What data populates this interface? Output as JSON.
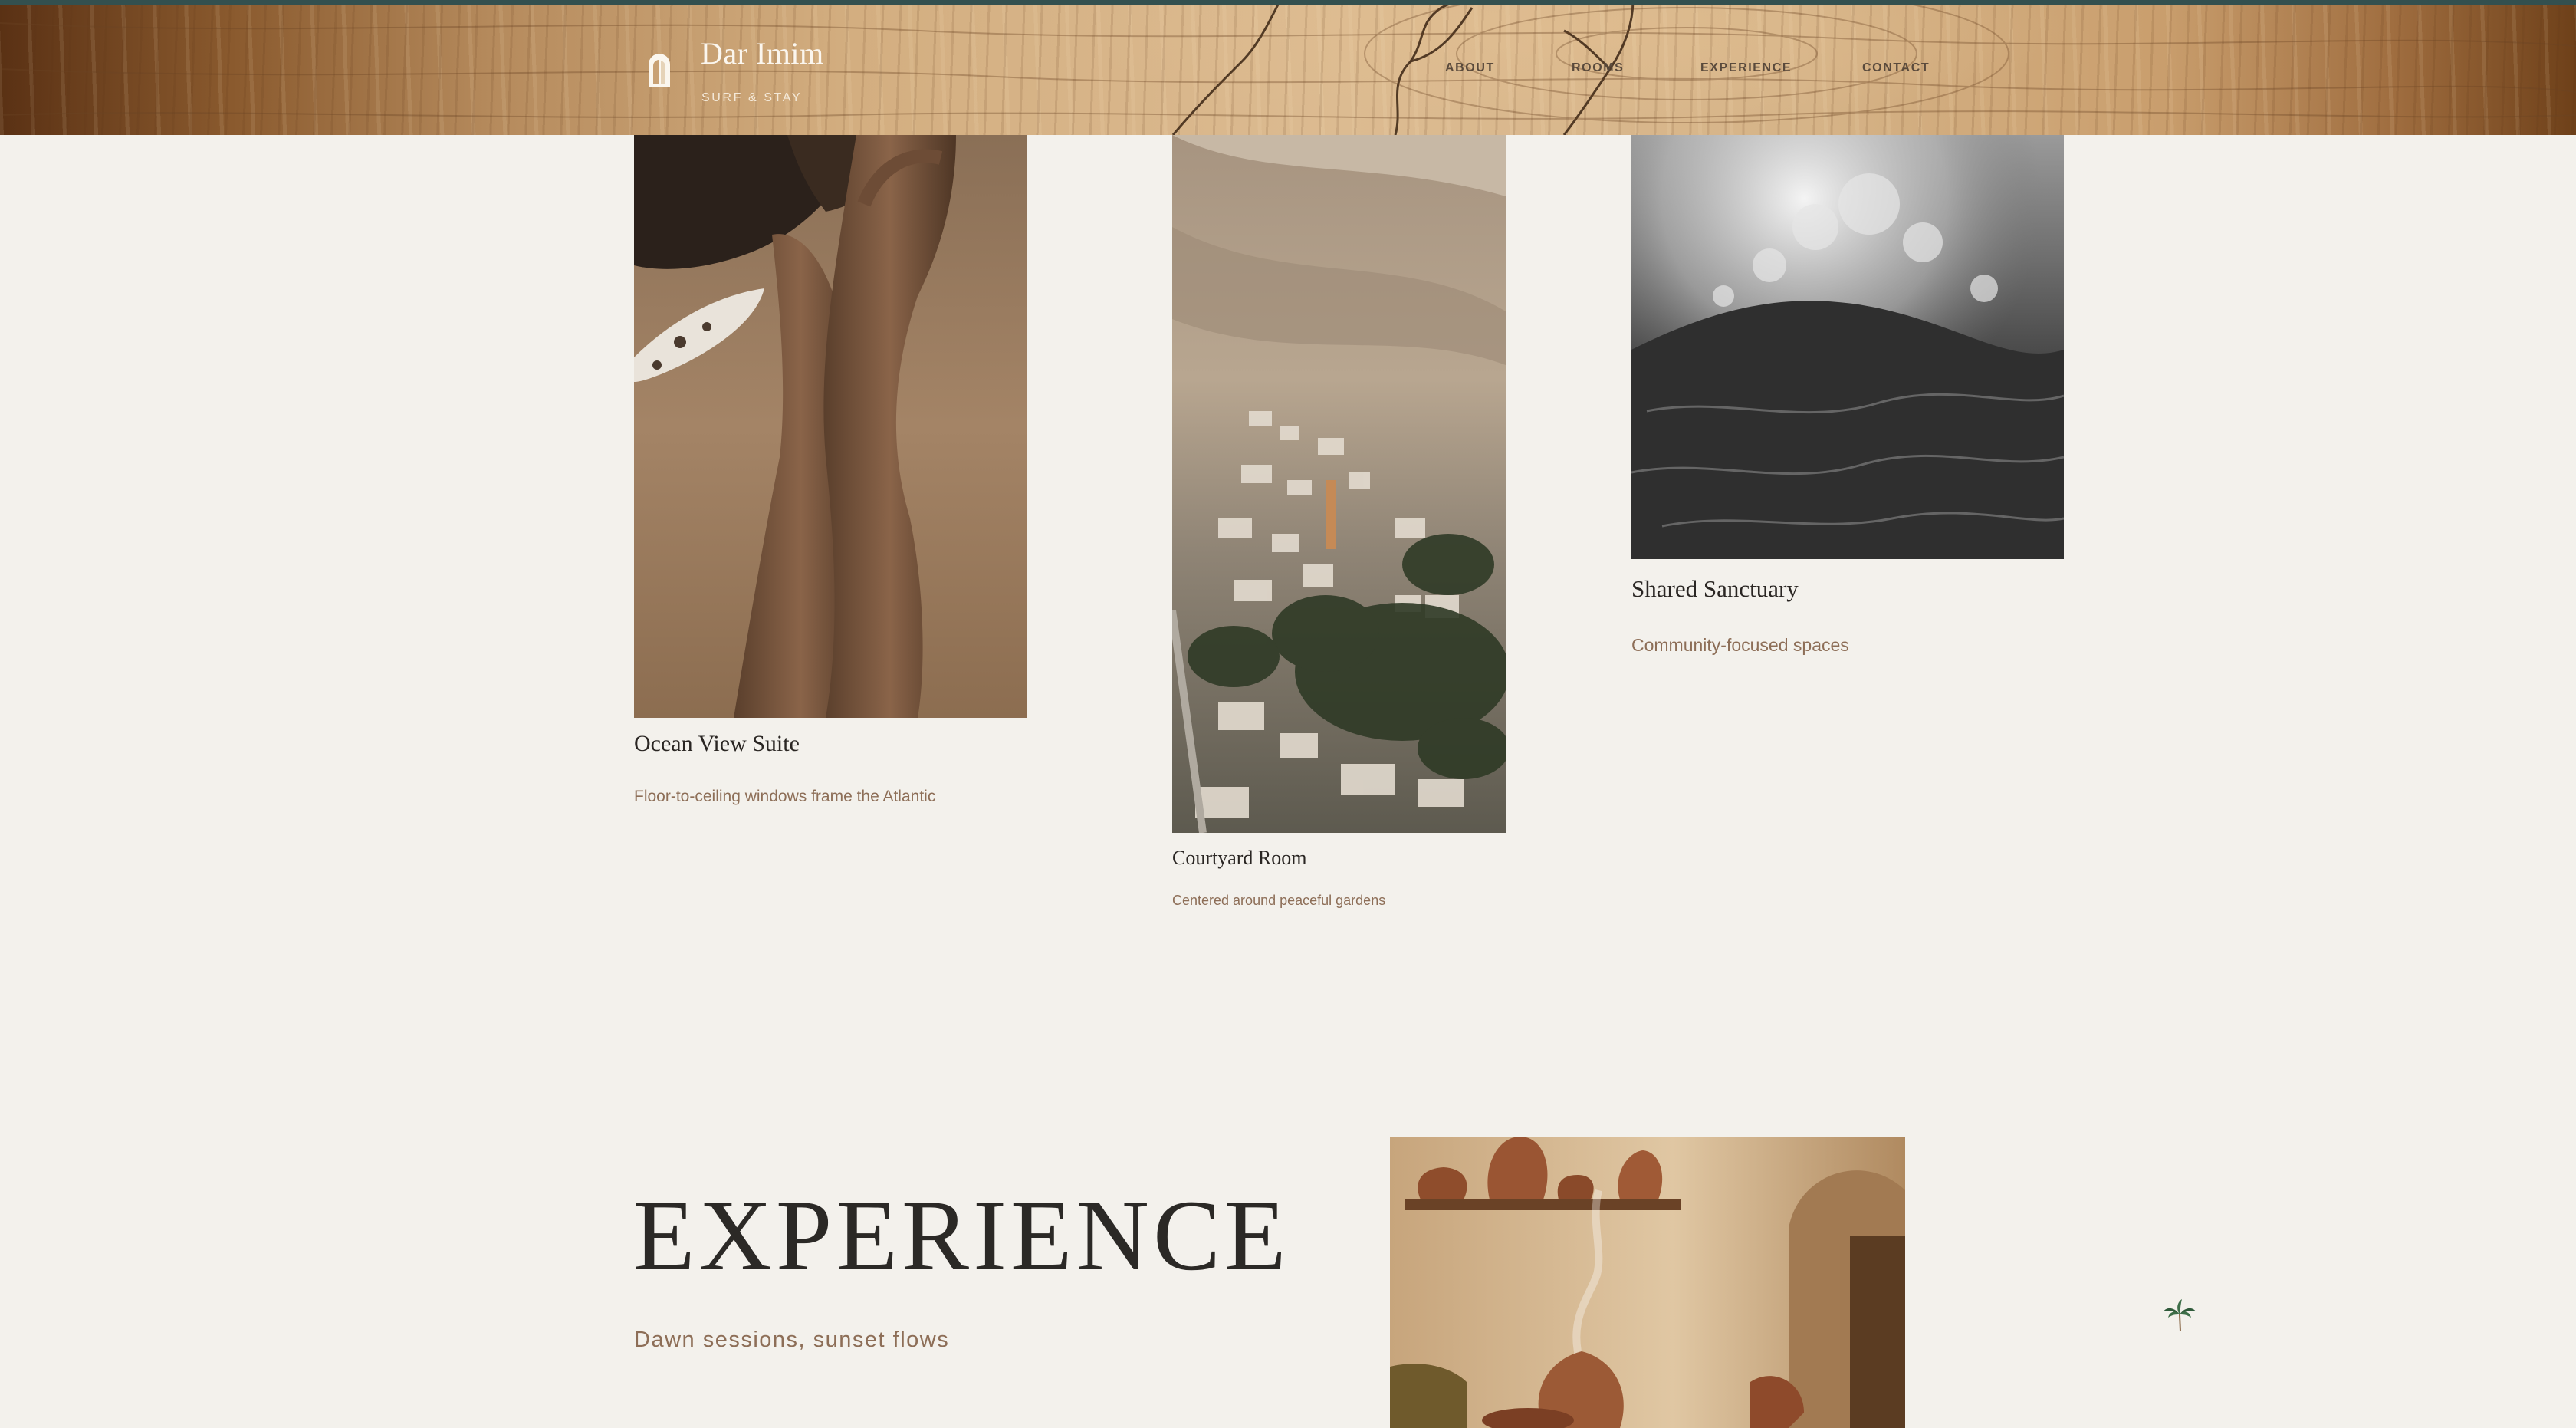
{
  "header": {
    "brand_name": "Dar Imim",
    "brand_tagline": "SURF & STAY",
    "logo_icon": "arch-door-icon",
    "nav": [
      {
        "label": "ABOUT"
      },
      {
        "label": "ROOMS"
      },
      {
        "label": "EXPERIENCE"
      },
      {
        "label": "CONTACT"
      }
    ]
  },
  "rooms": [
    {
      "title": "Ocean View Suite",
      "description": "Floor-to-ceiling windows frame the Atlantic",
      "image": "feet-on-sand-with-dog-photo"
    },
    {
      "title": "Courtyard Room",
      "description": "Centered around peaceful gardens",
      "image": "hillside-village-aerial-photo"
    },
    {
      "title": "Shared Sanctuary",
      "description": "Community-focused spaces",
      "image": "ocean-wave-bw-photo"
    }
  ],
  "experience": {
    "heading": "EXPERIENCE",
    "subtitle": "Dawn sessions, sunset flows",
    "image": "clay-pottery-incense-photo"
  },
  "floating_icon": "palm-tree-icon",
  "colors": {
    "background": "#f3f1ec",
    "accent_text": "#8d6e57",
    "heading_text": "#2b2926",
    "header_strip": "#33504f"
  }
}
